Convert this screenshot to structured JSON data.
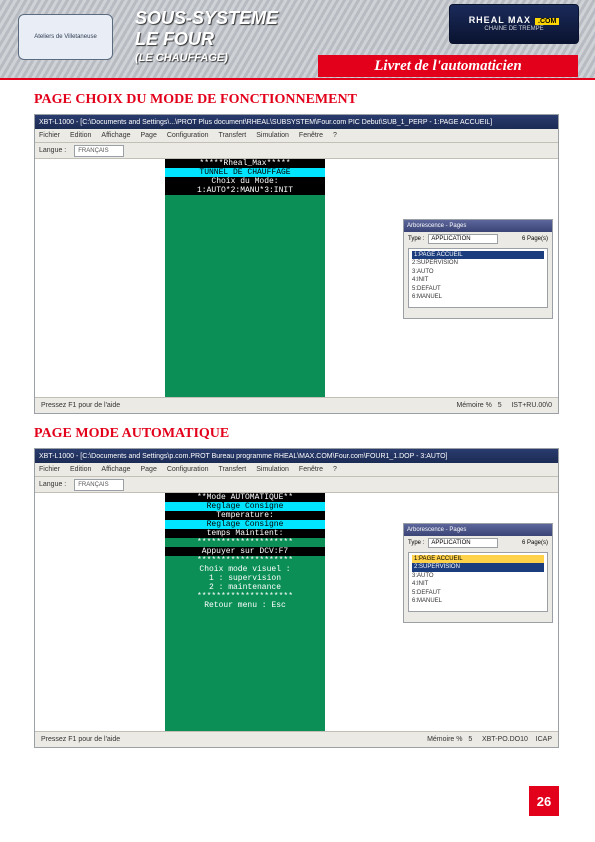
{
  "header": {
    "logo_caption": "Ateliers de Villetaneuse",
    "title_line1": "SOUS-SYSTEME",
    "title_line2": "LE FOUR",
    "title_line3": "(LE CHAUFFAGE)",
    "livret_label": "Livret de l'automaticien",
    "rheal_text": "RHEAL MAX",
    "rheal_com": ".COM",
    "rheal_sub": "CHAINE DE TREMPE"
  },
  "section1": {
    "title": "PAGE CHOIX DU MODE DE FONCTIONNEMENT",
    "window_title": "XBT-L1000 - [C:\\Documents and Settings\\...\\PROT Plus document\\RHEAL\\SUBSYSTEM\\Four.com PIC Debut\\SUB_1_PERP - 1:PAGE ACCUEIL]",
    "menu_items": [
      "Fichier",
      "Edition",
      "Affichage",
      "Page",
      "Configuration",
      "Transfert",
      "Simulation",
      "Fenêtre",
      "?"
    ],
    "toolbar_langue_label": "Langue :",
    "toolbar_langue_value": "FRANÇAIS",
    "terminal": {
      "l1": "*****Rheal_Max*****",
      "l2": "TUNNEL DE CHAUFFAGE",
      "l3": "Choix du Mode:",
      "l4": "1:AUTO*2:MANU*3:INIT"
    },
    "side_panel": {
      "header": "Arborescence - Pages",
      "type_label": "Type :",
      "type_value": "APPLICATION",
      "count_label": "6 Page(s)",
      "items": [
        "1:PAGE ACCUEIL",
        "2:SUPERVISION",
        "3:AUTO",
        "4:INIT",
        "5:DEFAUT",
        "6:MANUEL"
      ]
    },
    "status_left": "Pressez F1 pour de l'aide",
    "status_mid": "Mémoire %",
    "status_mid_val": "5",
    "status_right": "IST+RU.00\\0"
  },
  "section2": {
    "title": "PAGE MODE AUTOMATIQUE",
    "window_title": "XBT-L1000 - [C:\\Documents and Settings\\p.com.PROT Bureau programme RHEAL\\MAX.COM\\Four.com\\FOUR1_1.DOP - 3:AUTO]",
    "menu_items": [
      "Fichier",
      "Edition",
      "Affichage",
      "Page",
      "Configuration",
      "Transfert",
      "Simulation",
      "Fenêtre",
      "?"
    ],
    "toolbar_langue_label": "Langue :",
    "toolbar_langue_value": "FRANÇAIS",
    "terminal": {
      "l1": "**Mode AUTOMATIQUE**",
      "l2": "Reglage Consigne",
      "l3": "Temperature:",
      "l4": "Reglage Consigne",
      "l5": "temps Maintient:",
      "l6": "********************",
      "l7": "Appuyer sur DCV:F7",
      "l8": "********************",
      "l9": "Choix mode visuel :",
      "l10": "1 : supervision",
      "l11": "2 : maintenance",
      "l12": "********************",
      "l13": "Retour menu : Esc"
    },
    "side_panel": {
      "header": "Arborescence - Pages",
      "type_label": "Type :",
      "type_value": "APPLICATION",
      "count_label": "6 Page(s)",
      "items": [
        "1:PAGE ACCUEIL",
        "2:SUPERVISION",
        "3:AUTO",
        "4:INIT",
        "5:DEFAUT",
        "6:MANUEL"
      ]
    },
    "status_left": "Pressez F1 pour de l'aide",
    "status_mid": "Mémoire %",
    "status_mid_val": "5",
    "status_right1": "XBT-PO.DO10",
    "status_right2": "ICAP"
  },
  "page_number": "26"
}
